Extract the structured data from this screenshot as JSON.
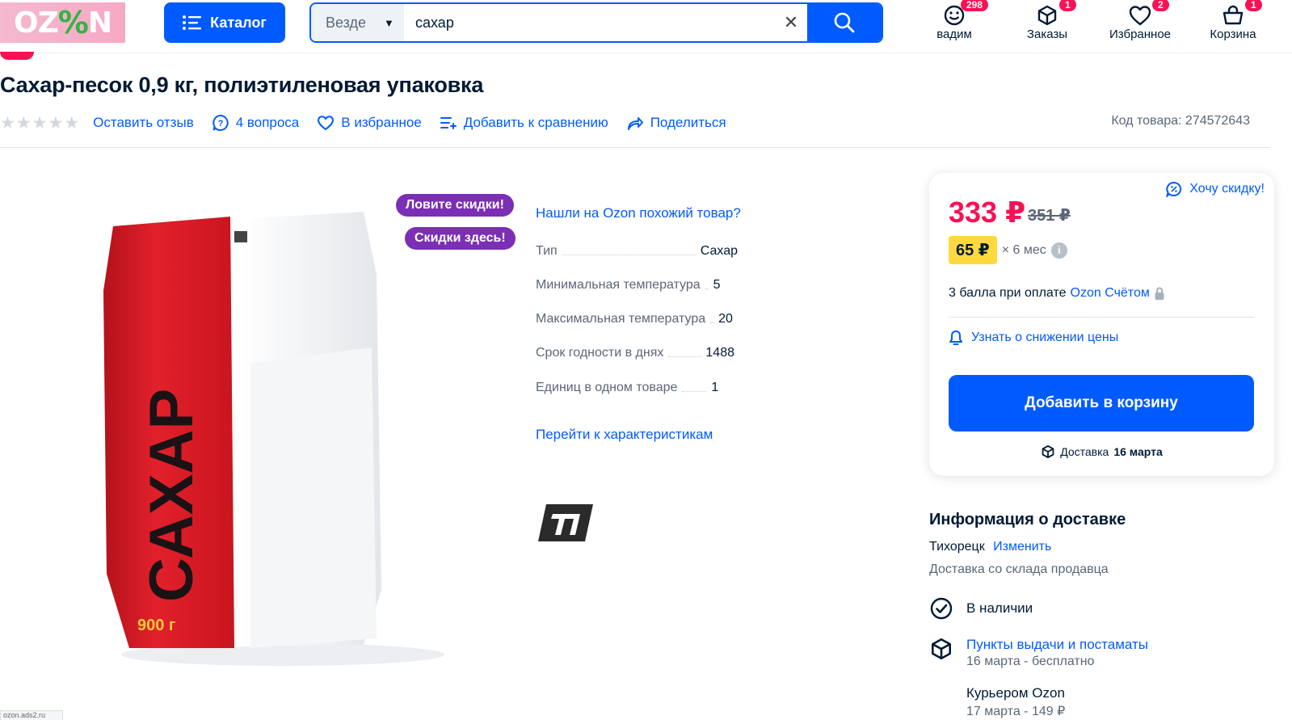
{
  "header": {
    "logo_text_left": "OZ",
    "logo_text_pct": "%",
    "logo_text_right": "N",
    "catalog_label": "Каталог",
    "search_scope": "Везде",
    "search_value": "сахар",
    "items": [
      {
        "label": "вадим",
        "badge": "298",
        "icon": "smile-icon"
      },
      {
        "label": "Заказы",
        "badge": "1",
        "icon": "box-icon"
      },
      {
        "label": "Избранное",
        "badge": "2",
        "icon": "heart-icon"
      },
      {
        "label": "Корзина",
        "badge": "1",
        "icon": "cart-icon"
      }
    ]
  },
  "product": {
    "title": "Сахар-песок 0,9 кг, полиэтиленовая упаковка",
    "actions": {
      "review": "Оставить отзыв",
      "questions": "4 вопроса",
      "favorite": "В избранное",
      "compare": "Добавить к сравнению",
      "share": "Поделиться"
    },
    "sku": "Код товара: 274572643",
    "promo_1": "Ловите скидки!",
    "promo_2": "Скидки здесь!",
    "package_text": "САХАР",
    "package_weight": "900 г"
  },
  "specs": {
    "similar_link": "Нашли на Ozon похожий товар?",
    "rows": [
      {
        "name": "Тип",
        "value": "Сахар"
      },
      {
        "name": "Минимальная температура",
        "value": "5"
      },
      {
        "name": "Максимальная температура",
        "value": "20"
      },
      {
        "name": "Срок годности в днях",
        "value": "1488"
      },
      {
        "name": "Единиц в одном товаре",
        "value": "1"
      }
    ],
    "go_link": "Перейти к характеристикам"
  },
  "price_card": {
    "want_discount": "Хочу скидку!",
    "price": "333 ₽",
    "old_price": "351 ₽",
    "installment_amount": "65 ₽",
    "installment_mult": "× 6 мес",
    "points_text": "3 балла при оплате",
    "points_link": "Ozon Счётом",
    "price_alert": "Узнать о снижении цены",
    "add_to_cart": "Добавить в корзину",
    "delivery_prefix": "Доставка",
    "delivery_date": "16 марта"
  },
  "delivery": {
    "title": "Информация о доставке",
    "city": "Тихорецк",
    "change": "Изменить",
    "from_stock": "Доставка со склада продавца",
    "in_stock": "В наличии",
    "pickup_title": "Пункты выдачи и постаматы",
    "pickup_sub": "16 марта - бесплатно",
    "courier_title": "Курьером Ozon",
    "courier_sub": "17 марта - 149 ₽"
  },
  "status_bar": "ozon.ads2.ru",
  "colors": {
    "brand_blue": "#005bff",
    "price_pink": "#f91155",
    "promo_purple": "#7b2fb5",
    "installment_yellow": "#ffd93d"
  }
}
